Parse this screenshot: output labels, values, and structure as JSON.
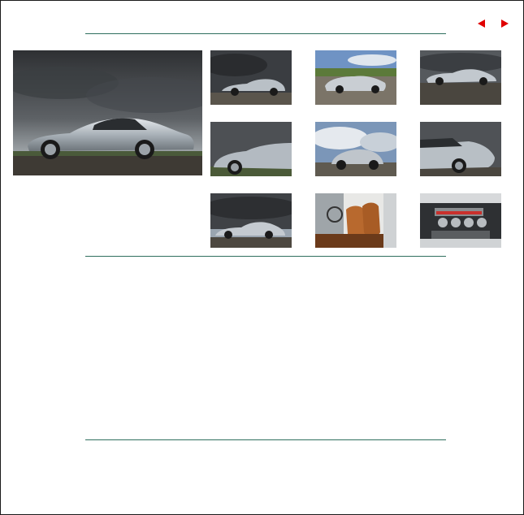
{
  "navigation": {
    "prev": {
      "icon": "triangle-left-icon",
      "color": "#e00000"
    },
    "next": {
      "icon": "triangle-right-icon",
      "color": "#e00000"
    }
  },
  "colors": {
    "divider": "#2f6f5e",
    "border": "#1a1a1a",
    "background": "#ffffff"
  },
  "gallery": {
    "main_photo": {
      "subject": "silver-coupe-side-view-stormy-sky"
    },
    "thumbnails": [
      {
        "subject": "coupe-side-dark-sky"
      },
      {
        "subject": "coupe-front-three-quarter-blue-sky"
      },
      {
        "subject": "coupe-side-profile"
      },
      {
        "subject": "coupe-rear-quarter-closeup"
      },
      {
        "subject": "coupe-front-low-angle"
      },
      {
        "subject": "coupe-rear-closeup"
      },
      {
        "subject": "coupe-side-overcast"
      },
      {
        "subject": "interior-tan-leather-seats"
      },
      {
        "subject": "engine-bay-v12"
      }
    ]
  }
}
